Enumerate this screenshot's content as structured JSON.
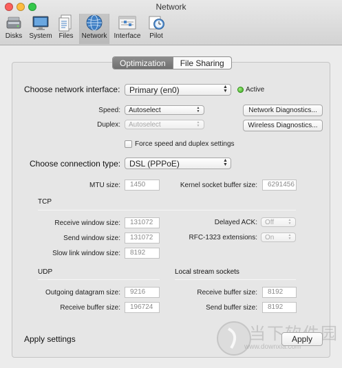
{
  "window": {
    "title": "Network"
  },
  "toolbar": {
    "items": [
      {
        "label": "Disks",
        "icon": "disks-icon"
      },
      {
        "label": "System",
        "icon": "system-icon"
      },
      {
        "label": "Files",
        "icon": "files-icon"
      },
      {
        "label": "Network",
        "icon": "network-icon"
      },
      {
        "label": "Interface",
        "icon": "interface-icon"
      },
      {
        "label": "Pilot",
        "icon": "pilot-icon"
      }
    ],
    "selected": "Network"
  },
  "tabs": [
    {
      "label": "Optimization"
    },
    {
      "label": "File Sharing"
    }
  ],
  "selected_tab": "Optimization",
  "interface": {
    "label": "Choose network interface:",
    "value": "Primary (en0)",
    "status": "Active",
    "status_color": "#3aa21f"
  },
  "speed": {
    "label": "Speed:",
    "value": "Autoselect"
  },
  "duplex": {
    "label": "Duplex:",
    "value": "Autoselect"
  },
  "buttons": {
    "network_diagnostics": "Network Diagnostics...",
    "wireless_diagnostics": "Wireless Diagnostics...",
    "apply": "Apply"
  },
  "force_checkbox": {
    "label": "Force speed and duplex settings",
    "checked": false
  },
  "connection": {
    "label": "Choose connection type:",
    "value": "DSL (PPPoE)"
  },
  "mtu": {
    "label": "MTU size:",
    "value": "1450"
  },
  "kernel_buffer": {
    "label": "Kernel socket buffer size:",
    "value": "6291456"
  },
  "tcp": {
    "title": "TCP",
    "receive_window": {
      "label": "Receive window size:",
      "value": "131072"
    },
    "send_window": {
      "label": "Send window size:",
      "value": "131072"
    },
    "slow_link_window": {
      "label": "Slow link window size:",
      "value": "8192"
    },
    "delayed_ack": {
      "label": "Delayed ACK:",
      "value": "Off"
    },
    "rfc1323": {
      "label": "RFC-1323 extensions:",
      "value": "On"
    }
  },
  "udp": {
    "title": "UDP",
    "outgoing_datagram": {
      "label": "Outgoing datagram size:",
      "value": "9216"
    },
    "receive_buffer": {
      "label": "Receive buffer size:",
      "value": "196724"
    }
  },
  "local_stream": {
    "title": "Local stream sockets",
    "receive_buffer": {
      "label": "Receive buffer size:",
      "value": "8192"
    },
    "send_buffer": {
      "label": "Send buffer size:",
      "value": "8192"
    }
  },
  "footer": {
    "label": "Apply settings"
  },
  "watermark": {
    "text": "当下软件园",
    "url": "www.downxia.com"
  }
}
